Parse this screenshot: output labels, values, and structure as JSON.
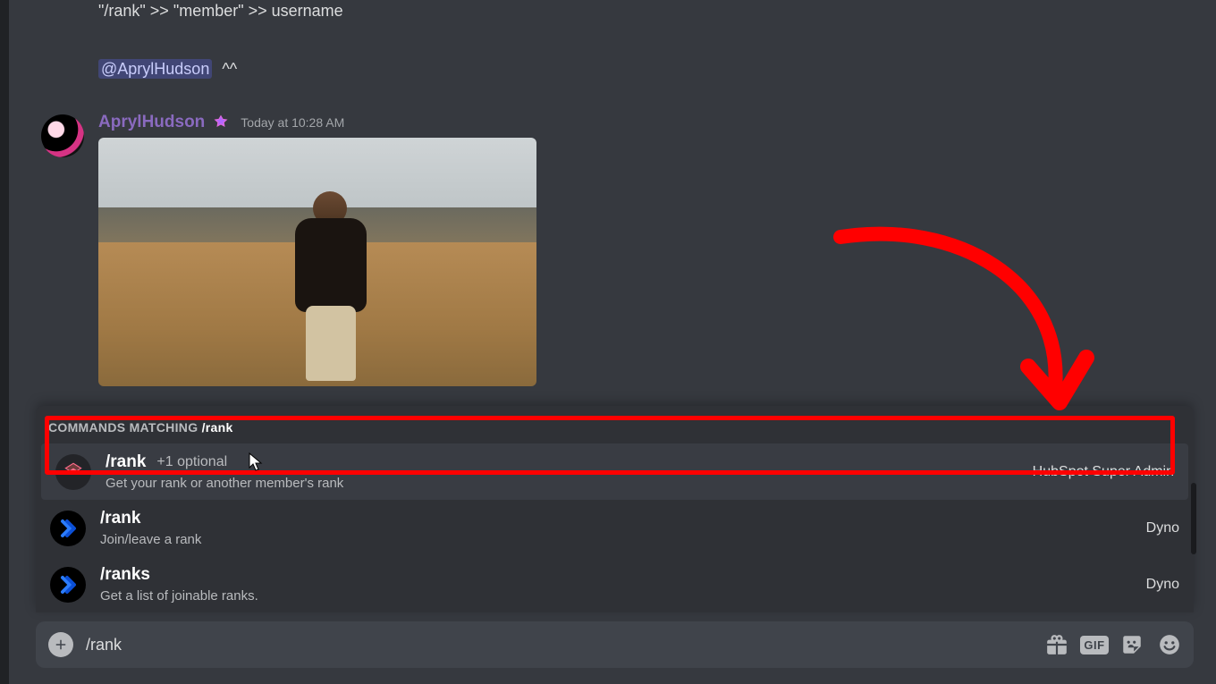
{
  "messages": {
    "msg1_text": "\"/rank\" >> \"member\" >> username",
    "mention": "@AprylHudson",
    "caret": "^^"
  },
  "msg2": {
    "username": "AprylHudson",
    "timestamp": "Today at 10:28 AM"
  },
  "autocomplete": {
    "header_prefix": "Commands Matching",
    "query": "/rank",
    "items": [
      {
        "command": "/rank",
        "optional": "+1 optional",
        "description": "Get your rank or another member's rank",
        "source": "HubSpot Super Admin",
        "icon": "hubspot",
        "selected": true
      },
      {
        "command": "/rank",
        "optional": "",
        "description": "Join/leave a rank",
        "source": "Dyno",
        "icon": "dyno",
        "selected": false
      },
      {
        "command": "/ranks",
        "optional": "",
        "description": "Get a list of joinable ranks.",
        "source": "Dyno",
        "icon": "dyno",
        "selected": false
      }
    ]
  },
  "input": {
    "value": "/rank",
    "gif_label": "GIF"
  }
}
